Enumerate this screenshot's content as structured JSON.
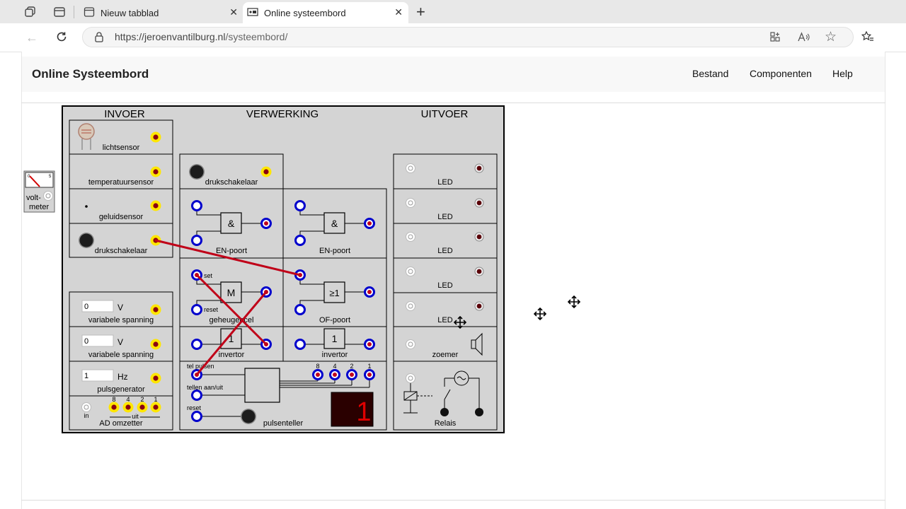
{
  "browser": {
    "tabs": [
      {
        "title": "Nieuw tabblad"
      },
      {
        "title": "Online systeembord"
      }
    ],
    "url_host": "https://jeroenvantilburg.nl",
    "url_path": "/systeembord/",
    "new_tab_symbol": "+"
  },
  "site": {
    "brand": "Online Systeembord",
    "menu": [
      "Bestand",
      "Componenten",
      "Help"
    ]
  },
  "board": {
    "headers": [
      "INVOER",
      "VERWERKING",
      "UITVOER"
    ],
    "invoer": {
      "lichtsensor": "lichtsensor",
      "temperatuursensor": "temperatuursensor",
      "geluidsensor": "geluidsensor",
      "drukschakelaar": "drukschakelaar",
      "var1_value": "0",
      "var1_unit": "V",
      "var1_label": "variabele spanning",
      "var2_value": "0",
      "var2_unit": "V",
      "var2_label": "variabele spanning",
      "puls_value": "1",
      "puls_unit": "Hz",
      "puls_label": "pulsgenerator",
      "ad_bits": [
        "8",
        "4",
        "2",
        "1"
      ],
      "ad_in": "in",
      "ad_uit": "uit",
      "ad_label": "AD omzetter"
    },
    "verwerking": {
      "druk_label": "drukschakelaar",
      "and_symbol": "&",
      "and_label": "EN-poort",
      "mem_symbol": "M",
      "mem_set": "set",
      "mem_reset": "reset",
      "mem_label": "geheugencel",
      "or_symbol": "≥1",
      "or_label": "OF-poort",
      "inv_symbol": "1",
      "inv_label": "invertor",
      "counter_tel": "tel pulsen",
      "counter_toggle": "tellen aan/uit",
      "counter_reset": "reset",
      "counter_bits": [
        "8",
        "4",
        "2",
        "1"
      ],
      "counter_label": "pulsenteller",
      "counter_display": "1"
    },
    "uitvoer": {
      "led_label": "LED",
      "zoemer_label": "zoemer",
      "relais_label": "Relais"
    }
  },
  "voltmeter": {
    "line1": "volt-",
    "line2": "meter",
    "scale_min": "0",
    "scale_max": "5"
  },
  "colors": {
    "wire": "#c00018",
    "input_port": "#0000cc",
    "output_port_fill": "#d4001c",
    "socket_ring": "#ffe600",
    "board_bg": "#d4d4d4"
  }
}
